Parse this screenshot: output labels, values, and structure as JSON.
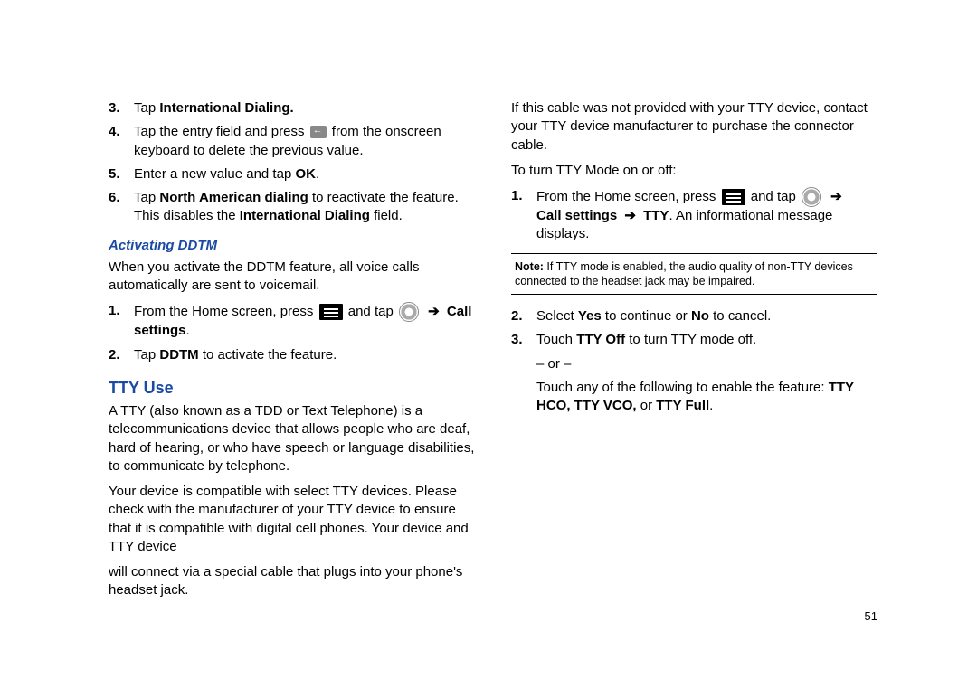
{
  "pageNumber": "51",
  "left": {
    "steps1": [
      {
        "n": "3.",
        "pre": "Tap ",
        "bold": "International Dialing."
      },
      {
        "n": "4.",
        "before": "Tap the entry field and press ",
        "after": " from the onscreen keyboard to delete the previous value.",
        "icon": "delete"
      },
      {
        "n": "5.",
        "before": "Enter a new value and tap ",
        "bold": "OK",
        "after": "."
      },
      {
        "n": "6.",
        "before": "Tap ",
        "bold": "North American dialing",
        "mid": " to reactivate the feature. This disables the ",
        "bold2": "International Dialing",
        "after": " field."
      }
    ],
    "ddtmHeading": "Activating DDTM",
    "ddtmIntro": "When you activate the DDTM feature, all voice calls automatically are sent to voicemail.",
    "ddtmSteps": {
      "s1_before": "From the Home screen, press ",
      "s1_mid": " and tap ",
      "s1_bold": "Call settings",
      "s2_before": "Tap ",
      "s2_bold": "DDTM",
      "s2_after": " to activate the feature."
    },
    "ttyHeading": "TTY Use",
    "ttyP1": "A TTY (also known as a TDD or Text Telephone) is a telecommunications device that allows people who are deaf, hard of hearing, or who have speech or language disabilities, to communicate by telephone.",
    "ttyP2": "Your device is compatible with select TTY devices. Please check with the manufacturer of your TTY device to ensure that it is compatible with digital cell phones. Your device and TTY device"
  },
  "right": {
    "cont1": "will connect via a special cable that plugs into your phone's headset jack.",
    "cont2": "If this cable was not provided with your TTY device, contact your TTY device manufacturer to purchase the connector cable.",
    "toTurn": "To turn TTY Mode on or off:",
    "s1_before": "From the Home screen, press ",
    "s1_mid": " and tap ",
    "s1_bold1": "Call settings",
    "s1_bold2": "TTY",
    "s1_after": ". An informational message displays.",
    "noteLabel": "Note:",
    "noteText": " If TTY mode is enabled, the audio quality of non-TTY devices connected to the headset jack may be impaired.",
    "s2_before": "Select ",
    "s2_b1": "Yes",
    "s2_mid": " to continue or ",
    "s2_b2": "No",
    "s2_after": " to cancel.",
    "s3_before": "Touch ",
    "s3_b": "TTY Off",
    "s3_after": " to turn TTY mode off.",
    "or": "– or –",
    "enable_before": "Touch any of the following to enable the feature: ",
    "enable_b": "TTY HCO, TTY VCO,",
    "enable_mid": " or ",
    "enable_b2": "TTY Full",
    "enable_after": "."
  }
}
